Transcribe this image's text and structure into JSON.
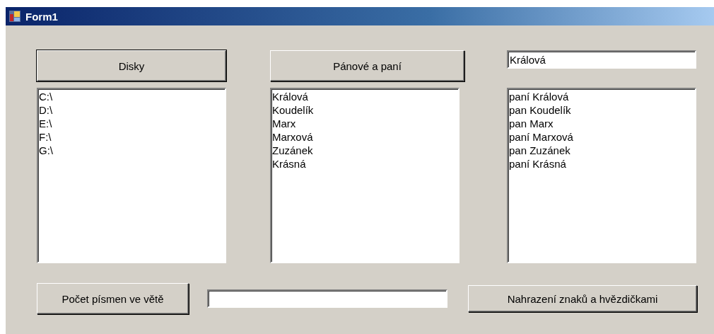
{
  "window": {
    "title": "Form1"
  },
  "columns": [
    {
      "button": {
        "label": "Disky",
        "default": true
      },
      "list": {
        "items": [
          "C:\\",
          "D:\\",
          "E:\\",
          "F:\\",
          "G:\\"
        ]
      }
    },
    {
      "button": {
        "label": "Pánové a paní",
        "default": false
      },
      "list": {
        "items": [
          "Králová",
          "Koudelík",
          "Marx",
          "Marxová",
          "Zuzánek",
          "Krásná"
        ]
      }
    },
    {
      "textbox": {
        "value": "Králová"
      },
      "list": {
        "items": [
          "paní Králová",
          "pan Koudelík",
          "pan Marx",
          "paní Marxová",
          "pan Zuzánek",
          "paní Krásná"
        ]
      }
    }
  ],
  "bottom": {
    "left_button": {
      "label": "Počet písmen ve větě"
    },
    "right_button": {
      "label": "Nahrazení znaků a hvězdičkami"
    }
  }
}
